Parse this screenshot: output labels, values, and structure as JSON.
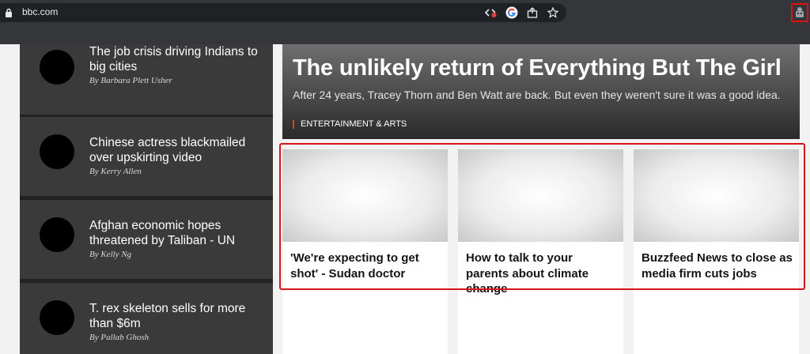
{
  "browser": {
    "url": "bbc.com",
    "icons": [
      "lock-icon",
      "cast-blocked-icon",
      "google-icon",
      "share-icon",
      "star-icon",
      "extension-icon"
    ]
  },
  "left_stories": [
    {
      "title": "The job crisis driving Indians to big cities",
      "byline": "By Barbara Plett Usher"
    },
    {
      "title": "Chinese actress blackmailed over upskirting video",
      "byline": "By Kerry Allen"
    },
    {
      "title": "Afghan economic hopes threatened by Taliban - UN",
      "byline": "By Kelly Ng"
    },
    {
      "title": "T. rex skeleton sells for more than $6m",
      "byline": "By Pallab Ghosh"
    }
  ],
  "hero": {
    "title": "The unlikely return of Everything But The Girl",
    "summary": "After 24 years, Tracey Thorn and Ben Watt are back. But even they weren't sure it was a good idea.",
    "tag": "ENTERTAINMENT & ARTS"
  },
  "cards": [
    {
      "title": "'We're expecting to get shot' - Sudan doctor"
    },
    {
      "title": "How to talk to your parents about climate change"
    },
    {
      "title": "Buzzfeed News to close as media firm cuts jobs"
    }
  ],
  "colors": {
    "highlight": "#d4161c",
    "tag_accent": "#e0401c"
  }
}
